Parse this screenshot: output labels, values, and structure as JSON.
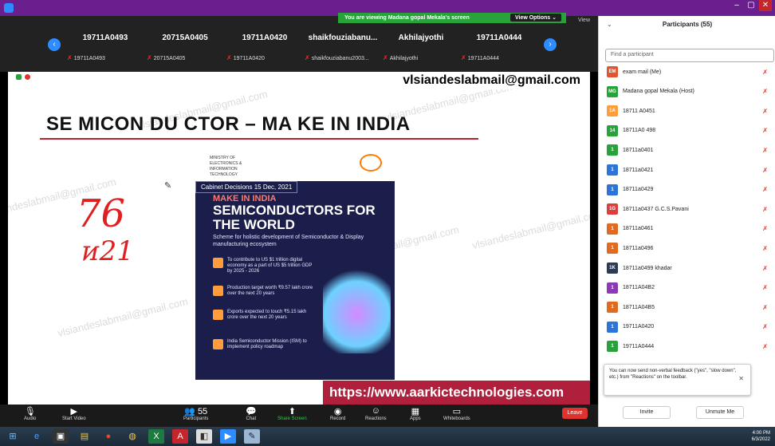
{
  "window": {
    "banner": "You are viewing Madana gopal Mekala's screen",
    "view_options": "View Options ⌄",
    "minimize": "–",
    "maximize": "▢",
    "close": "✕"
  },
  "strip": {
    "view": "View",
    "tiles": [
      {
        "name": "19711A0493",
        "sub": "19711A0493"
      },
      {
        "name": "20715A0405",
        "sub": "20715A0405"
      },
      {
        "name": "19711A0420",
        "sub": "19711A0420"
      },
      {
        "name": "shaikfouziabanu...",
        "sub": "shaikfouziabanu2003..."
      },
      {
        "name": "Akhilajyothi",
        "sub": "Akhilajyothi"
      },
      {
        "name": "19711A0444",
        "sub": "19711A0444"
      }
    ]
  },
  "recording": "Recording",
  "slide": {
    "email": "vlsiandeslabmail@gmail.com",
    "watermark": "vlsiandeslabmail@gmail.com",
    "title": "SE MICON DU CTOR – MA KE  IN  INDIA",
    "url": "https://www.aarkictechnologies.com",
    "handwriting": [
      "76",
      "ᴎ21"
    ],
    "poster": {
      "ministry": "MINISTRY OF ELECTRONICS & INFORMATION TECHNOLOGY",
      "cabinet": "Cabinet Decisions 15 Dec, 2021",
      "make": "MAKE IN INDIA",
      "headline": "SEMICONDUCTORS FOR THE WORLD",
      "scheme": "Scheme for holistic development of Semiconductor & Display manufacturing ecosystem",
      "items": [
        "To contribute to US $1 trillion digital economy as a part of US $5 trillion GDP by 2025 - 2026",
        "Production target worth ₹9.57 lakh crore over the next 20 years",
        "Exports expected to touch ₹5.15 lakh crore over the next 20 years",
        "India Semiconductor Mission (ISM) to implement policy roadmap"
      ],
      "digital": "Digital India"
    }
  },
  "toolbar": {
    "audio": "Audio",
    "video": "Start Video",
    "participants": "Participants",
    "participants_count": "55",
    "chat": "Chat",
    "share": "Share Screen",
    "record": "Record",
    "reactions": "Reactions",
    "apps": "Apps",
    "whiteboards": "Whiteboards",
    "leave": "Leave"
  },
  "panel": {
    "title": "Participants (55)",
    "search_placeholder": "Find a participant",
    "participants": [
      {
        "initials": "EM",
        "name": "exam mail (Me)",
        "color": "#e0552e"
      },
      {
        "initials": "MG",
        "name": "Madana gopal Mekala (Host)",
        "color": "#27a33a"
      },
      {
        "initials": "1A",
        "name": "18711 A0451",
        "color": "#ff9d3b"
      },
      {
        "initials": "14",
        "name": "18711A0 498",
        "color": "#27a33a"
      },
      {
        "initials": "1",
        "name": "18711a0401",
        "color": "#27a33a"
      },
      {
        "initials": "1",
        "name": "18711a0421",
        "color": "#2d74da"
      },
      {
        "initials": "1",
        "name": "18711a0429",
        "color": "#2d74da"
      },
      {
        "initials": "1G",
        "name": "18711a0437 G.C.S.Pavani",
        "color": "#d93f3f"
      },
      {
        "initials": "1",
        "name": "18711a0461",
        "color": "#e06a1f"
      },
      {
        "initials": "1",
        "name": "18711a0496",
        "color": "#e06a1f"
      },
      {
        "initials": "1K",
        "name": "18711a0499 khadar",
        "color": "#2a3d55"
      },
      {
        "initials": "1",
        "name": "18711A04B2",
        "color": "#8b3ab5"
      },
      {
        "initials": "1",
        "name": "18711A04B5",
        "color": "#e06a1f"
      },
      {
        "initials": "1",
        "name": "19711A0420",
        "color": "#2d74da"
      },
      {
        "initials": "1",
        "name": "19711A0444",
        "color": "#27a33a"
      }
    ],
    "tip": "You can now send non-verbal feedback (\"yes\", \"slow down\", etc.) from \"Reactions\" on the toolbar.",
    "invite": "Invite",
    "unmute": "Unmute Me"
  },
  "taskbar": {
    "time": "4:00 PM",
    "date": "6/3/2022"
  }
}
